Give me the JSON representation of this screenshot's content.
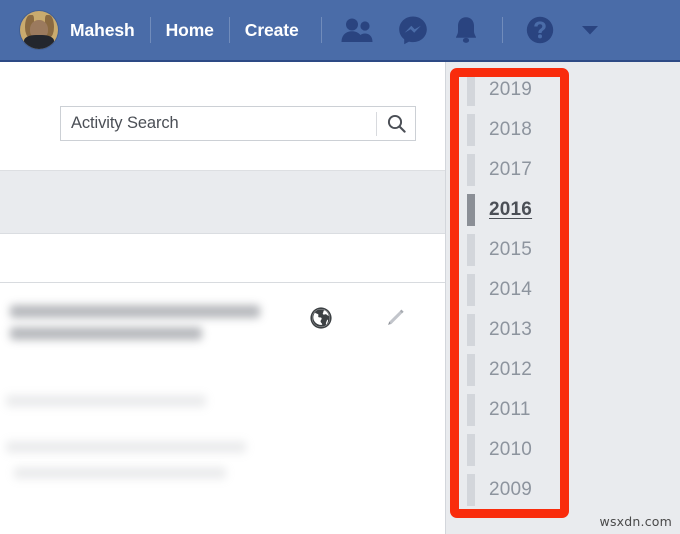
{
  "topbar": {
    "bg_color": "#4a6ca8",
    "avatar_name": "avatar",
    "profile_name": "Mahesh",
    "links": [
      {
        "label": "Home",
        "name": "nav-link-home"
      },
      {
        "label": "Create",
        "name": "nav-link-create"
      }
    ],
    "icons": [
      {
        "name": "friend-requests-icon",
        "label": "Friend Requests"
      },
      {
        "name": "messenger-icon",
        "label": "Messenger"
      },
      {
        "name": "notifications-bell-icon",
        "label": "Notifications"
      },
      {
        "name": "help-question-icon",
        "label": "Help"
      },
      {
        "name": "account-chevron-down-icon",
        "label": "Account Settings"
      }
    ]
  },
  "search": {
    "value": "Activity Search",
    "placeholder": "Activity Search",
    "icon": "search-icon"
  },
  "content": {
    "privacy_icon": "globe-public-icon",
    "edit_icon": "pencil-edit-icon"
  },
  "year_filter": {
    "active_year": "2016",
    "years": [
      "2019",
      "2018",
      "2017",
      "2016",
      "2015",
      "2014",
      "2013",
      "2012",
      "2011",
      "2010",
      "2009"
    ]
  },
  "annotation": {
    "name": "red-highlight-rectangle",
    "color": "#f92c0c"
  },
  "watermark": {
    "text": "wsxdn.com"
  }
}
